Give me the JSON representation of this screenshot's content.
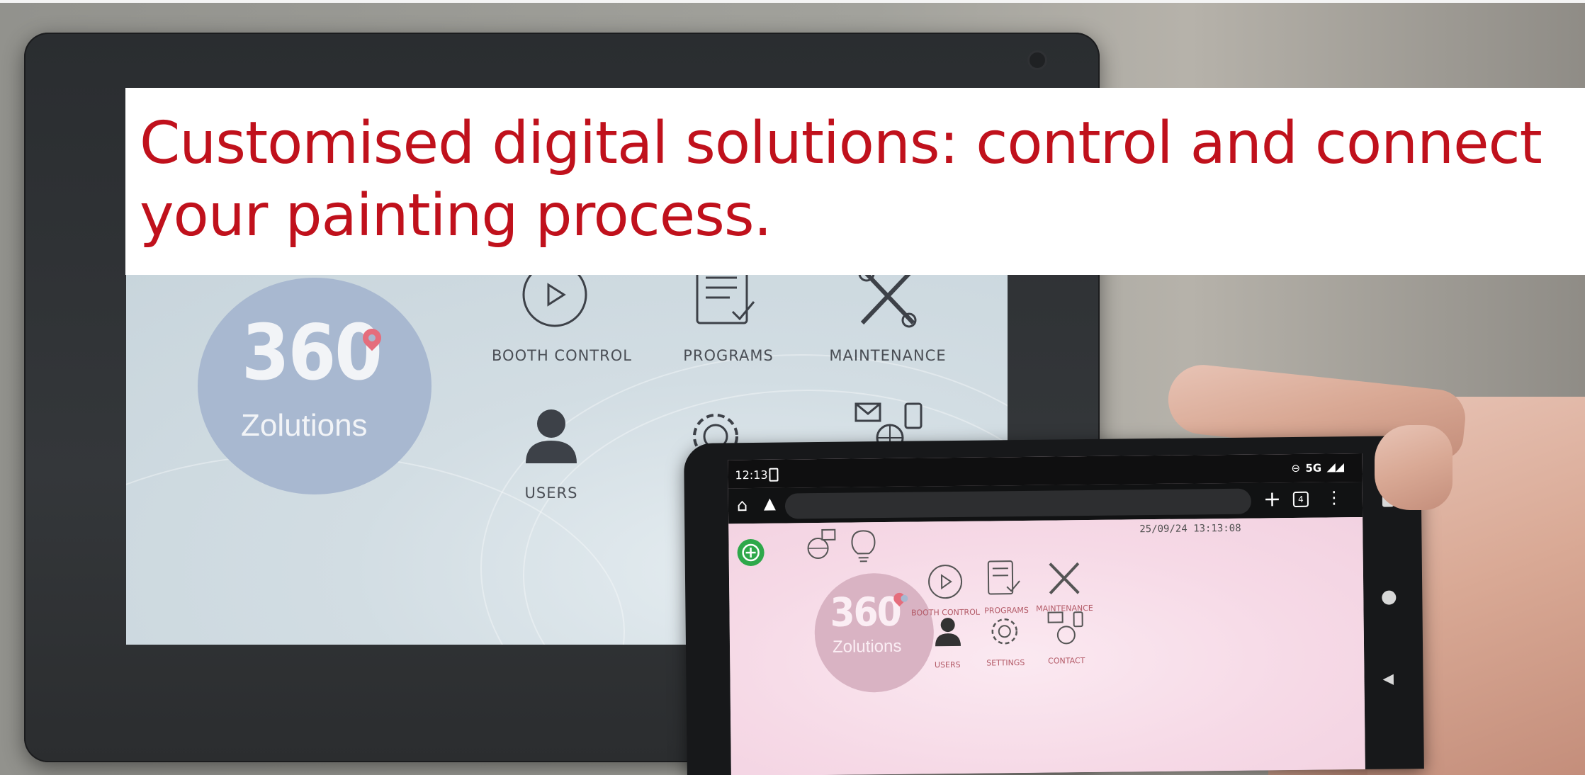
{
  "banner": {
    "headline": "Customised digital solutions: control and connect your painting process.",
    "headline_color": "#c0111c"
  },
  "tablet_screen": {
    "logo_number": "360",
    "logo_word": "Zolutions",
    "menu": [
      {
        "label": "BOOTH CONTROL",
        "icon": "play-circle-icon"
      },
      {
        "label": "PROGRAMS",
        "icon": "checklist-icon"
      },
      {
        "label": "MAINTENANCE",
        "icon": "tools-icon"
      },
      {
        "label": "USERS",
        "icon": "user-icon"
      },
      {
        "label": "",
        "icon": "gear-icon"
      },
      {
        "label": "",
        "icon": "contact-network-icon"
      }
    ]
  },
  "phone_screen": {
    "status_time": "12:13",
    "status_network": "5G",
    "tab_count": "4",
    "datetime": "25/09/24 13:13:08",
    "logo_number": "360",
    "logo_word": "Zolutions",
    "menu": [
      {
        "label": "BOOTH CONTROL",
        "icon": "play-circle-icon"
      },
      {
        "label": "PROGRAMS",
        "icon": "checklist-icon"
      },
      {
        "label": "MAINTENANCE",
        "icon": "tools-icon"
      },
      {
        "label": "USERS",
        "icon": "user-icon"
      },
      {
        "label": "SETTINGS",
        "icon": "gear-icon"
      },
      {
        "label": "CONTACT",
        "icon": "contact-network-icon"
      }
    ]
  },
  "colors": {
    "logo_circle_tablet": "#a8b8d0",
    "logo_circle_phone": "#d9b3c3",
    "pin": "#e56d7c",
    "add_button": "#2ea84a"
  }
}
